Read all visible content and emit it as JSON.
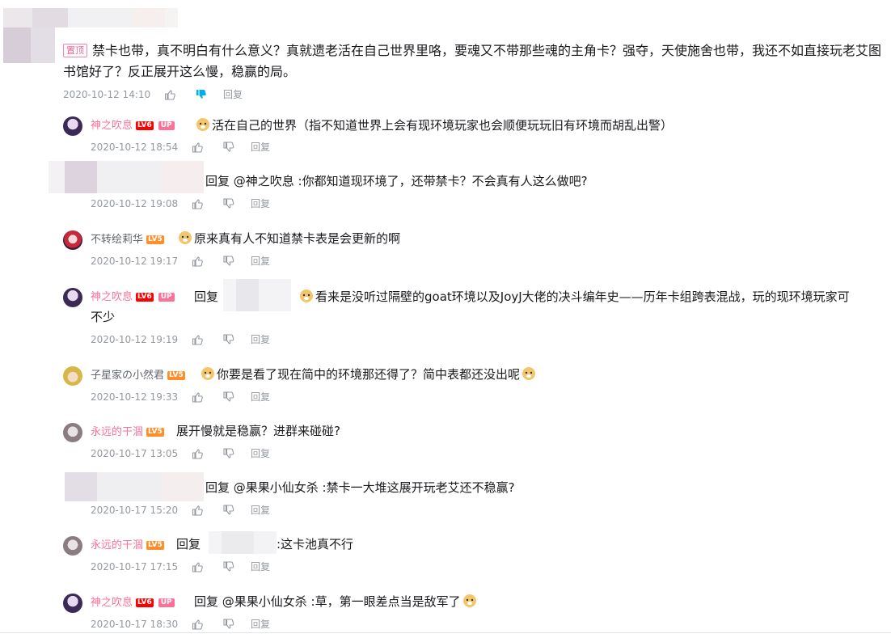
{
  "top_comment": {
    "badge": "置顶",
    "text": "禁卡也带，真不明白有什么意义？真就遗老活在自己世界里咯，要魂又不带那些魂的主角卡？强夺，天使施舍也带，我还不如直接玩老艾图书馆好了？反正展开这么慢，稳赢的局。",
    "time": "2020-10-12 14:10",
    "reply_label": "回复"
  },
  "replies": [
    {
      "user": "神之吹息",
      "level": "LV6",
      "up": "UP",
      "text": "活在自己的世界（指不知道世界上会有现环境玩家也会顺便玩玩旧有环境而胡乱出警）",
      "time": "2020-10-12 18:54",
      "reply_label": "回复"
    },
    {
      "user": "",
      "text_prefix": "回复 @神之吹息 :",
      "text": "你都知道现环境了，还带禁卡？不会真有人这么做吧?",
      "time": "2020-10-12 19:08",
      "reply_label": "回复"
    },
    {
      "user": "不转绘莉华",
      "level": "LV5",
      "text": "原来真有人不知道禁卡表是会更新的啊",
      "time": "2020-10-12 19:17",
      "reply_label": "回复"
    },
    {
      "user": "神之吹息",
      "level": "LV6",
      "up": "UP",
      "text_prefix": "回复",
      "text_line1": "看来是没听过隔壁的goat环境以及JoyJ大佬的决斗编年史——历年卡组跨表混战，玩的现环境玩家可",
      "text_line2": "不少",
      "time": "2020-10-12 19:19",
      "reply_label": "回复"
    },
    {
      "user": "子星家の小然君",
      "level": "LV5",
      "text": "你要是看了现在简中的环境那还得了？简中表都还没出呢",
      "time": "2020-10-12 19:33",
      "reply_label": "回复"
    },
    {
      "user": "永远的干涸",
      "level": "LV5",
      "text": "展开慢就是稳赢？进群来碰碰?",
      "time": "2020-10-17 13:05",
      "reply_label": "回复"
    },
    {
      "user": "",
      "text_prefix": "回复 @果果小仙女杀 :",
      "text": "禁卡一大堆这展开玩老艾还不稳赢?",
      "time": "2020-10-17 15:20",
      "reply_label": "回复"
    },
    {
      "user": "永远的干涸",
      "level": "LV5",
      "text_prefix": "回复",
      "text": ":这卡池真不行",
      "time": "2020-10-17 17:15",
      "reply_label": "回复"
    },
    {
      "user": "神之吹息",
      "level": "LV6",
      "up": "UP",
      "text_prefix": "回复 @果果小仙女杀 :",
      "text": "草，第一眼差点当是敌军了",
      "time": "2020-10-17 18:30",
      "reply_label": "回复"
    }
  ],
  "colors": {
    "pink": "#fb7299",
    "meta_gray": "#9499a0",
    "lv6": "#ff0000",
    "lv5": "#ff8e29",
    "dislike_active": "#00aeec"
  },
  "icons": {
    "like": "thumb-up-icon",
    "dislike": "thumb-down-icon",
    "emoji": "doge-emoji-icon"
  }
}
